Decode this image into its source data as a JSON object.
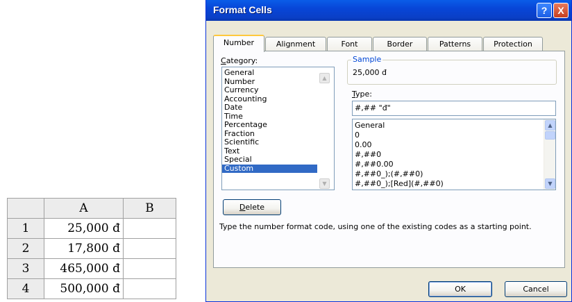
{
  "spreadsheet": {
    "columns": [
      "A",
      "B"
    ],
    "rows": [
      {
        "num": "1",
        "a": "25,000 đ",
        "b": ""
      },
      {
        "num": "2",
        "a": "17,800 đ",
        "b": ""
      },
      {
        "num": "3",
        "a": "465,000 đ",
        "b": ""
      },
      {
        "num": "4",
        "a": "500,000 đ",
        "b": ""
      }
    ]
  },
  "dialog": {
    "title": "Format Cells",
    "help_label": "?",
    "close_label": "X",
    "tabs": [
      "Number",
      "Alignment",
      "Font",
      "Border",
      "Patterns",
      "Protection"
    ],
    "active_tab": "Number",
    "category_label_ul": "C",
    "category_label_rest": "ategory:",
    "categories": [
      "General",
      "Number",
      "Currency",
      "Accounting",
      "Date",
      "Time",
      "Percentage",
      "Fraction",
      "Scientific",
      "Text",
      "Special",
      "Custom"
    ],
    "selected_category": "Custom",
    "sample_legend": "Sample",
    "sample_value": "25,000 đ",
    "type_label_ul": "T",
    "type_label_rest": "ype:",
    "type_value": "#,## \"đ\"",
    "format_codes": [
      "General",
      "0",
      "0.00",
      "#,##0",
      "#,##0.00",
      "#,##0_);(#,##0)",
      "#,##0_);[Red](#,##0)"
    ],
    "delete_label_ul": "D",
    "delete_label_rest": "elete",
    "description": "Type the number format code, using one of the existing codes as a starting point.",
    "ok_label": "OK",
    "cancel_label": "Cancel",
    "colors": {
      "title_bar": "#0a3fc6",
      "selection": "#316ac5",
      "dialog_bg": "#ece9d8"
    }
  }
}
